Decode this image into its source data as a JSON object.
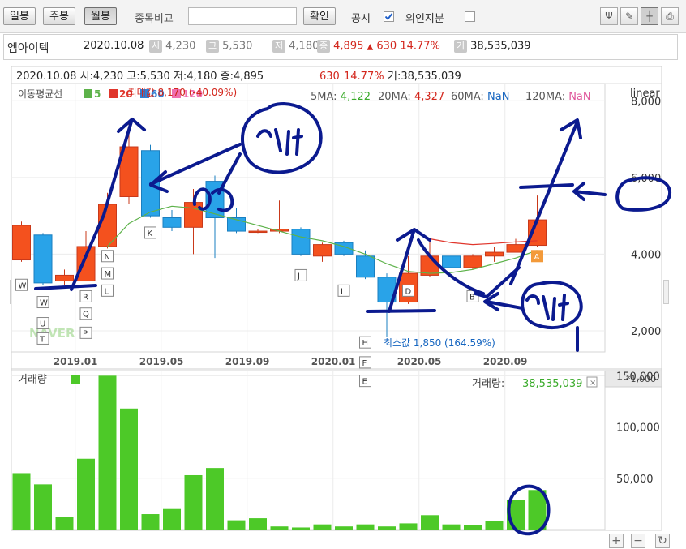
{
  "toolbar": {
    "period_buttons": [
      "일봉",
      "주봉",
      "월봉"
    ],
    "active_period": "월봉",
    "compare_label": "종목비교",
    "compare_input": "",
    "confirm_label": "확인",
    "disclosure_label": "공시",
    "foreign_label": "외인지분"
  },
  "stock": {
    "name": "엠아이텍",
    "date": "2020.10.08",
    "open_label": "시",
    "open": "4,230",
    "high_label": "고",
    "high": "5,530",
    "low_label": "저",
    "low": "4,180",
    "close_label": "종",
    "close": "4,895",
    "change": "630",
    "change_pct": "14.77%",
    "volume_label": "거",
    "volume": "38,535,039",
    "change_arrow": "▲"
  },
  "colors": {
    "up": "#f4511e",
    "down": "#29a3e8",
    "ma5": "#5db24a",
    "ma20": "#e0362c",
    "ma60": "#2f7fd6",
    "ma120": "#ef6fb0",
    "volume": "#4dc928",
    "annotation": "#0b1a8f"
  },
  "chart_data": [
    {
      "type": "candlestick",
      "ohlc_line": "2020.10.08 시:4,230 고:5,530 저:4,180 종:4,895",
      "ohlc_change": "630",
      "ohlc_change_pct": "14.77%",
      "ohlc_volume": "거:38,535,039",
      "legend_title": "이동평균선",
      "legend": [
        {
          "name": "5",
          "color": "#5db24a"
        },
        {
          "name": "20",
          "color": "#e0362c"
        },
        {
          "name": "60",
          "color": "#2f7fd6"
        },
        {
          "name": "120",
          "color": "#ef6fb0"
        }
      ],
      "ma_values": [
        {
          "label": "5MA:",
          "value": "4,122",
          "color": "#3aab2a"
        },
        {
          "label": "20MA:",
          "value": "4,327",
          "color": "#d3261c"
        },
        {
          "label": "60MA:",
          "value": "NaN",
          "color": "#1565c0"
        },
        {
          "label": "120MA:",
          "value": "NaN",
          "color": "#e0559a"
        }
      ],
      "scale": "linear",
      "ylim": [
        1450,
        8450
      ],
      "y_ticks": [
        2000,
        4000,
        6000,
        8000
      ],
      "y_tick_labels": [
        "2,000",
        "4,000",
        "6,000",
        "8,000"
      ],
      "x_tick_labels": [
        {
          "label": "2019.01",
          "index": 2.5
        },
        {
          "label": "2019.05",
          "index": 6.5
        },
        {
          "label": "2019.09",
          "index": 10.5
        },
        {
          "label": "2020.01",
          "index": 14.5
        },
        {
          "label": "2020.05",
          "index": 18.5
        },
        {
          "label": "2020.09",
          "index": 22.5
        }
      ],
      "candles": [
        {
          "o": 3850,
          "h": 4850,
          "l": 3800,
          "c": 4750
        },
        {
          "o": 4500,
          "h": 4550,
          "l": 3200,
          "c": 3250
        },
        {
          "o": 3300,
          "h": 3600,
          "l": 3200,
          "c": 3450
        },
        {
          "o": 3300,
          "h": 4600,
          "l": 3300,
          "c": 4200
        },
        {
          "o": 4200,
          "h": 5600,
          "l": 4150,
          "c": 5300
        },
        {
          "o": 5500,
          "h": 7400,
          "l": 5300,
          "c": 6800
        },
        {
          "o": 6700,
          "h": 6850,
          "l": 4950,
          "c": 5000
        },
        {
          "o": 4950,
          "h": 5150,
          "l": 4600,
          "c": 4700
        },
        {
          "o": 4700,
          "h": 5700,
          "l": 4000,
          "c": 5350
        },
        {
          "o": 5900,
          "h": 6050,
          "l": 3900,
          "c": 4950
        },
        {
          "o": 4950,
          "h": 5200,
          "l": 4550,
          "c": 4600
        },
        {
          "o": 4600,
          "h": 4650,
          "l": 4550,
          "c": 4600
        },
        {
          "o": 4600,
          "h": 5400,
          "l": 4550,
          "c": 4650
        },
        {
          "o": 4650,
          "h": 4700,
          "l": 3950,
          "c": 4000
        },
        {
          "o": 3950,
          "h": 4300,
          "l": 3800,
          "c": 4250
        },
        {
          "o": 4300,
          "h": 4350,
          "l": 3950,
          "c": 4000
        },
        {
          "o": 3950,
          "h": 4100,
          "l": 3350,
          "c": 3400
        },
        {
          "o": 3400,
          "h": 3500,
          "l": 1850,
          "c": 2750
        },
        {
          "o": 2750,
          "h": 3950,
          "l": 2700,
          "c": 3500
        },
        {
          "o": 3450,
          "h": 4400,
          "l": 3400,
          "c": 3950
        },
        {
          "o": 3950,
          "h": 3950,
          "l": 3650,
          "c": 3650
        },
        {
          "o": 3650,
          "h": 4000,
          "l": 3600,
          "c": 3950
        },
        {
          "o": 3950,
          "h": 4200,
          "l": 3800,
          "c": 4050
        },
        {
          "o": 4050,
          "h": 4400,
          "l": 4050,
          "c": 4250
        },
        {
          "o": 4230,
          "h": 5530,
          "l": 4180,
          "c": 4895
        }
      ],
      "ma20_line": [
        {
          "i": 4,
          "v": 4200
        },
        {
          "i": 5,
          "v": 4800
        },
        {
          "i": 6,
          "v": 5100
        },
        {
          "i": 7,
          "v": 5250
        },
        {
          "i": 8,
          "v": 5200
        },
        {
          "i": 9,
          "v": 5050
        },
        {
          "i": 10,
          "v": 4900
        },
        {
          "i": 11,
          "v": 4750
        },
        {
          "i": 12,
          "v": 4600
        },
        {
          "i": 13,
          "v": 4450
        },
        {
          "i": 14,
          "v": 4350
        },
        {
          "i": 15,
          "v": 4200
        },
        {
          "i": 16,
          "v": 4000
        },
        {
          "i": 17,
          "v": 3750
        },
        {
          "i": 18,
          "v": 3550
        },
        {
          "i": 19,
          "v": 3500
        },
        {
          "i": 20,
          "v": 3520
        },
        {
          "i": 21,
          "v": 3600
        },
        {
          "i": 22,
          "v": 3750
        },
        {
          "i": 23,
          "v": 3900
        },
        {
          "i": 24,
          "v": 4100
        }
      ],
      "ma5_line": [
        {
          "i": 19,
          "v": 4400
        },
        {
          "i": 20,
          "v": 4300
        },
        {
          "i": 21,
          "v": 4250
        },
        {
          "i": 22,
          "v": 4280
        },
        {
          "i": 23,
          "v": 4320
        },
        {
          "i": 24,
          "v": 4350
        }
      ],
      "annotations": [
        {
          "text": "최대값 8,170 (-40.09%)",
          "index": 5.4,
          "value": 8130,
          "color": "#d3261c"
        },
        {
          "text": "최소값 1,850 (164.59%)",
          "index": 17.3,
          "value": 1600,
          "color": "#1565c0"
        }
      ],
      "flags": [
        {
          "t": "W",
          "i": 0,
          "v": 3200
        },
        {
          "t": "W",
          "i": 1,
          "v": 2750
        },
        {
          "t": "U",
          "i": 1,
          "v": 2200
        },
        {
          "t": "T",
          "i": 1,
          "v": 1800
        },
        {
          "t": "N",
          "i": 4,
          "v": 3950
        },
        {
          "t": "M",
          "i": 4,
          "v": 3500
        },
        {
          "t": "L",
          "i": 4,
          "v": 3050
        },
        {
          "t": "R",
          "i": 3,
          "v": 2900
        },
        {
          "t": "Q",
          "i": 3,
          "v": 2450
        },
        {
          "t": "P",
          "i": 3,
          "v": 1950
        },
        {
          "t": "K",
          "i": 6,
          "v": 4560
        },
        {
          "t": "J",
          "i": 13,
          "v": 3450
        },
        {
          "t": "I",
          "i": 15,
          "v": 3050
        },
        {
          "t": "H",
          "i": 16,
          "v": 1700
        },
        {
          "t": "D",
          "i": 18,
          "v": 3050
        },
        {
          "t": "B",
          "i": 21,
          "v": 2900
        },
        {
          "t": "A",
          "i": 24,
          "v": 3950
        }
      ],
      "watermark": "NAVER"
    },
    {
      "type": "bar",
      "title": "거래량",
      "legend_label": "거래량:",
      "legend_value": "38,535,039",
      "unit": "*1,000",
      "ylim": [
        0,
        155000
      ],
      "y_ticks": [
        50000,
        100000,
        150000
      ],
      "y_tick_labels": [
        "50,000",
        "100,000",
        "150,000"
      ],
      "values": [
        55000,
        44000,
        12000,
        69000,
        150000,
        118000,
        15000,
        20000,
        53000,
        60000,
        9000,
        11000,
        3000,
        2000,
        5000,
        3000,
        5000,
        3000,
        6000,
        14000,
        5000,
        4000,
        8000,
        29000,
        38535
      ],
      "flags": [
        {
          "t": "F",
          "i": 16,
          "v": 163000
        },
        {
          "t": "E",
          "i": 16,
          "v": 145000
        }
      ]
    }
  ]
}
